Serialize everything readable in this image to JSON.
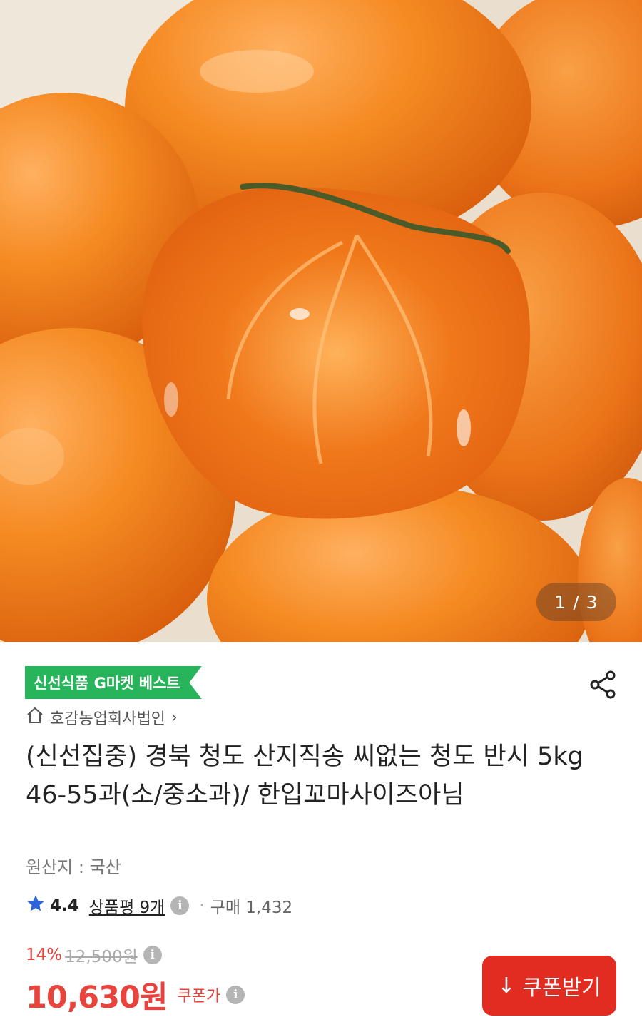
{
  "gallery": {
    "counter": "1 / 3",
    "image_label": "persimmon product photo"
  },
  "product": {
    "badge": "신선식품 G마켓 베스트",
    "seller": "호감농업회사법인",
    "seller_chevron": "›",
    "title": "(신선집중) 경북 청도 산지직송 씨없는 청도 반시 5kg 46-55과(소/중소과)/ 한입꼬마사이즈아님",
    "origin": "원산지 : 국산"
  },
  "rating": {
    "score": "4.4",
    "reviews": "상품평 9개",
    "dot": "·",
    "purchases": "구매 1,432"
  },
  "pricing": {
    "discount_rate": "14%",
    "original_price": "12,500원",
    "price": "10,630원",
    "price_label": "쿠폰가",
    "info_glyph": "i"
  },
  "coupon_button": {
    "label": "쿠폰받기",
    "arrow": "↓"
  },
  "colors": {
    "accent_red": "#e22c22",
    "badge_green": "#28b45a",
    "star_blue": "#2f63d8"
  },
  "icons": [
    "home-icon",
    "share-icon",
    "star-icon",
    "info-icon",
    "download-arrow-icon"
  ]
}
